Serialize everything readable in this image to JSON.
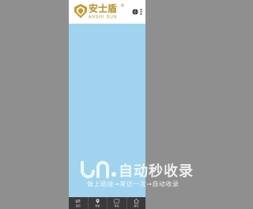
{
  "header": {
    "logo_title": "安士盾",
    "logo_sub": "ANSHI DUN",
    "logo_reg": "®"
  },
  "nav": {
    "items": [
      {
        "label": "首页",
        "icon": "home-exchange-icon"
      },
      {
        "label": "导航",
        "icon": "location-pin-icon"
      },
      {
        "label": "联系",
        "icon": "map-icon"
      },
      {
        "label": "首页",
        "icon": "house-icon"
      }
    ]
  },
  "watermark": {
    "title": "自动秒收录",
    "subtitle": "做上链接→来访一次→自动收录"
  },
  "colors": {
    "page_bg": "#8f8f8f",
    "content_bg": "#9fd3ee",
    "brand_gold": "#b78d27",
    "nav_bg": "#3a3a3a"
  }
}
